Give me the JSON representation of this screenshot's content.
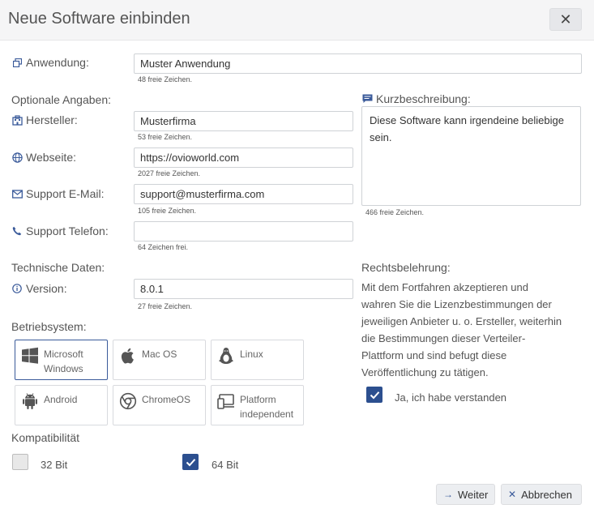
{
  "dialog": {
    "title": "Neue Software einbinden",
    "close_label": "✕"
  },
  "anwendung": {
    "label": "Anwendung:",
    "value": "Muster Anwendung",
    "hint": "48 freie Zeichen."
  },
  "optional": {
    "heading": "Optionale Angaben:",
    "hersteller": {
      "label": "Hersteller:",
      "value": "Musterfirma",
      "hint": "53 freie Zeichen."
    },
    "webseite": {
      "label": "Webseite:",
      "value": "https://ovioworld.com",
      "hint": "2027 freie Zeichen."
    },
    "email": {
      "label": "Support E-Mail:",
      "value": "support@musterfirma.com",
      "hint": "105 freie Zeichen."
    },
    "telefon": {
      "label": "Support Telefon:",
      "value": "",
      "hint": "64 Zeichen frei."
    }
  },
  "kurz": {
    "label": "Kurzbeschreibung:",
    "value_line1": "Diese Software kann irgendeine beliebige",
    "value_line2": "sein.",
    "hint": "466 freie Zeichen."
  },
  "technisch": {
    "heading": "Technische Daten:",
    "version": {
      "label": "Version:",
      "value": "8.0.1",
      "hint": "27 freie Zeichen."
    }
  },
  "betriebssystem": {
    "heading": "Betriebsystem:",
    "items": [
      {
        "line1": "Microsoft",
        "line2": "Windows",
        "icon": "windows-icon",
        "selected": true
      },
      {
        "line1": "Mac OS",
        "line2": "",
        "icon": "apple-icon",
        "selected": false
      },
      {
        "line1": "Linux",
        "line2": "",
        "icon": "linux-icon",
        "selected": false
      },
      {
        "line1": "Android",
        "line2": "",
        "icon": "android-icon",
        "selected": false
      },
      {
        "line1": "ChromeOS",
        "line2": "",
        "icon": "chrome-icon",
        "selected": false
      },
      {
        "line1": "Platform",
        "line2": "independent",
        "icon": "devices-icon",
        "selected": false
      }
    ]
  },
  "kompatibilitaet": {
    "heading": "Kompatibilität",
    "bit32": {
      "label": "32 Bit",
      "checked": false
    },
    "bit64": {
      "label": "64 Bit",
      "checked": true
    }
  },
  "rechtsbelehrung": {
    "heading": "Rechtsbelehrung:",
    "lines": [
      "Mit dem Fortfahren akzeptieren und",
      "wahren Sie die Lizenzbestimmungen der",
      "jeweiligen Anbieter u. o. Ersteller, weiterhin",
      "die Bestimmungen dieser Verteiler-",
      "Plattform und sind befugt diese",
      "Veröffentlichung zu tätigen."
    ],
    "confirm_label": "Ja, ich habe verstanden",
    "confirm_checked": true
  },
  "footer": {
    "weiter_label": "Weiter",
    "abbrechen_label": "Abbrechen"
  },
  "colors": {
    "accent": "#2c4f8f",
    "icon": "#3a5a9a",
    "header_bg": "#f5f5f6"
  }
}
